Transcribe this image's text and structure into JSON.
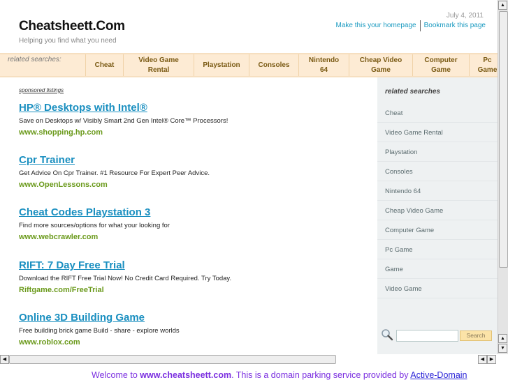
{
  "header": {
    "logo": "Cheatsheett.Com",
    "tagline": "Helping you find what you need",
    "date": "July 4, 2011",
    "links": [
      "Make this your homepage",
      "Bookmark this page"
    ]
  },
  "navbar": {
    "label": "related searches:",
    "items": [
      "Cheat",
      "Video Game Rental",
      "Playstation",
      "Consoles",
      "Nintendo 64",
      "Cheap Video Game",
      "Computer Game",
      "Pc Game"
    ]
  },
  "sponsored_label": "sponsored listings",
  "ads": [
    {
      "title": "HP® Desktops with Intel®",
      "desc": "Save on Desktops w/ Visibly Smart 2nd Gen Intel® Core™ Processors!",
      "url": "www.shopping.hp.com"
    },
    {
      "title": "Cpr Trainer",
      "desc": "Get Advice On Cpr Trainer. #1 Resource For Expert Peer Advice.",
      "url": "www.OpenLessons.com"
    },
    {
      "title": "Cheat Codes Playstation 3",
      "desc": "Find more sources/options for what your looking for",
      "url": "www.webcrawler.com"
    },
    {
      "title": "RIFT: 7 Day Free Trial",
      "desc": "Download the RIFT Free Trial Now! No Credit Card Required. Try Today.",
      "url": "Riftgame.com/FreeTrial"
    },
    {
      "title": "Online 3D Building Game",
      "desc": "Free building brick game Build - share - explore worlds",
      "url": "www.roblox.com"
    }
  ],
  "sidebar": {
    "heading": "related searches",
    "items": [
      "Cheat",
      "Video Game Rental",
      "Playstation",
      "Consoles",
      "Nintendo 64",
      "Cheap Video Game",
      "Computer Game",
      "Pc Game",
      "Game",
      "Video Game"
    ],
    "search_value": "",
    "search_button": "Search"
  },
  "footer": {
    "prefix": "Welcome to ",
    "domain": "www.cheatsheett.com",
    "middle": ". This is a domain parking service provided by ",
    "link": "Active-Domain"
  }
}
